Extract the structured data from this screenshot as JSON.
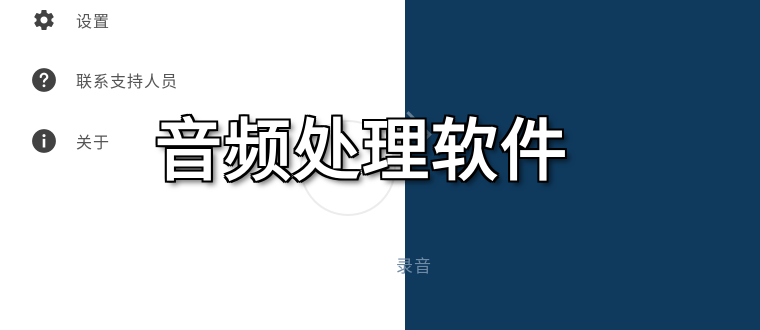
{
  "drawer": {
    "items": [
      {
        "label": "设置",
        "icon": "gear-icon"
      },
      {
        "label": "联系支持人员",
        "icon": "help-icon"
      },
      {
        "label": "关于",
        "icon": "info-icon"
      }
    ]
  },
  "main": {
    "record_label": "录音"
  },
  "overlay": {
    "title": "音频处理软件"
  },
  "colors": {
    "panel_bg": "#0f3a5e",
    "icon_fill": "#424242",
    "label_text": "#555555"
  }
}
